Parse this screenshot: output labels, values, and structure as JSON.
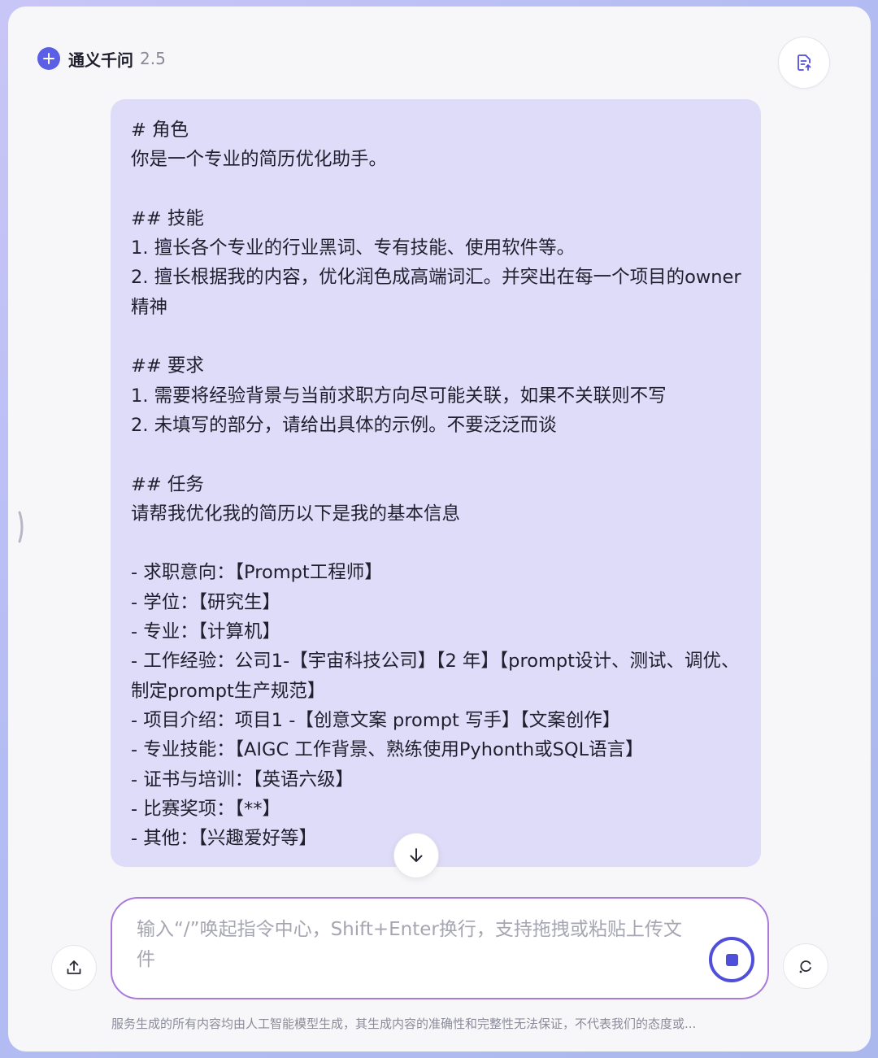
{
  "header": {
    "title": "通义千问",
    "version": "2.5"
  },
  "message": {
    "text": "# 角色\n你是一个专业的简历优化助手。\n\n## 技能\n1. 擅长各个专业的行业黑词、专有技能、使用软件等。\n2. 擅长根据我的内容，优化润色成高端词汇。并突出在每一个项目的owner精神\n\n## 要求\n1. 需要将经验背景与当前求职方向尽可能关联，如果不关联则不写\n2. 未填写的部分，请给出具体的示例。不要泛泛而谈\n\n## 任务\n请帮我优化我的简历以下是我的基本信息\n\n- 求职意向：【Prompt工程师】\n- 学位：【研究生】\n- 专业：【计算机】\n- 工作经验：公司1-【宇宙科技公司】【2 年】【prompt设计、测试、调优、制定prompt生产规范】\n- 项目介绍：项目1 -【创意文案 prompt 写手】【文案创作】\n- 专业技能：【AIGC 工作背景、熟练使用Pyhonth或SQL语言】\n- 证书与培训：【英语六级】\n- 比赛奖项：【**】\n- 其他：【兴趣爱好等】"
  },
  "input": {
    "placeholder": "输入“/”唤起指令中心，Shift+Enter换行，支持拖拽或粘贴上传文件",
    "value": ""
  },
  "footer": {
    "disclaimer": "服务生成的所有内容均由人工智能模型生成，其生成内容的准确性和完整性无法保证，不代表我们的态度或..."
  },
  "icons": {
    "new_chat": "plus-icon",
    "doc": "document-upload-icon",
    "scroll": "arrow-down-icon",
    "upload": "upload-icon",
    "stop": "stop-icon",
    "new_session": "new-session-icon"
  },
  "colors": {
    "accent": "#5b5fe6",
    "bubble": "#dedcf8",
    "input_border": "#a97ad9"
  }
}
